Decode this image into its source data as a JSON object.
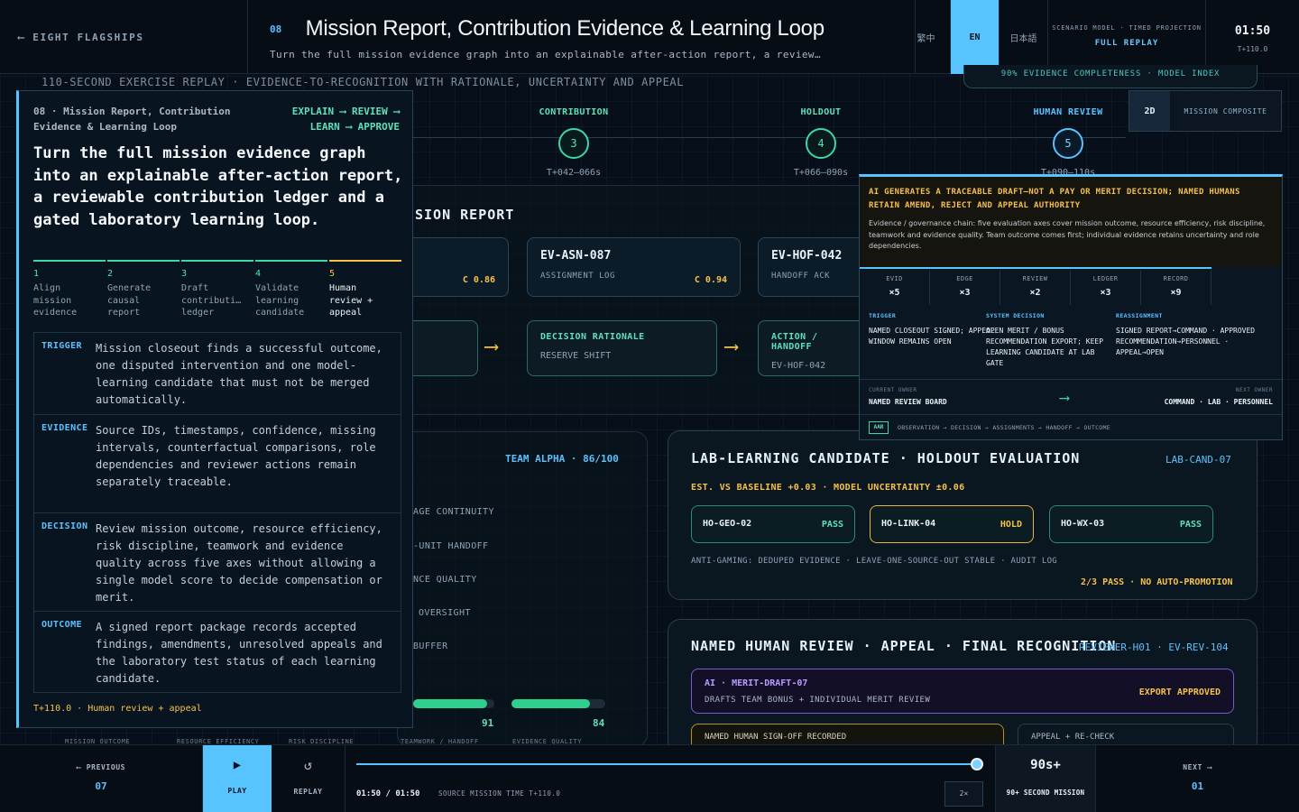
{
  "nav": {
    "back_label": "EIGHT FLAGSHIPS",
    "back_icon": "arrow-left-icon"
  },
  "header": {
    "number": "08",
    "title": "Mission Report, Contribution Evidence & Learning Loop",
    "subtitle": "Turn the full mission evidence graph into an explainable after-action report, a review…"
  },
  "languages": [
    "繁中",
    "EN",
    "日本語"
  ],
  "active_language": "EN",
  "mode": {
    "label": "SCENARIO MODEL · TIMED PROJECTION",
    "value": "FULL REPLAY"
  },
  "clock": {
    "time": "01:50",
    "offset": "T+110.0"
  },
  "subheader": "110-SECOND EXERCISE REPLAY · EVIDENCE-TO-RECOGNITION WITH RATIONALE, UNCERTAINTY AND APPEAL",
  "completeness_tab": "90% EVIDENCE COMPLETENESS · MODEL INDEX",
  "timeline": [
    {
      "label": "CONTRIBUTION",
      "number": "3",
      "time": "T+042–066s"
    },
    {
      "label": "HOLDOUT",
      "number": "4",
      "time": "T+066–090s"
    },
    {
      "label": "HUMAN REVIEW",
      "number": "5",
      "time": "T+090–110s"
    }
  ],
  "view_toggle": {
    "mode_2d": "2D",
    "composite": "MISSION COMPOSITE"
  },
  "mission_report": {
    "title": "SION REPORT",
    "evidence_cards": [
      {
        "id": "",
        "kind": "",
        "confidence": "C 0.86"
      },
      {
        "id": "EV-ASN-087",
        "kind": "ASSIGNMENT LOG",
        "confidence": "C 0.94"
      },
      {
        "id": "EV-HOF-042",
        "kind": "HANDOFF ACK",
        "confidence": ""
      }
    ],
    "flow_cards": [
      {
        "id": "DECISION RATIONALE",
        "kind": "RESERVE SHIFT"
      },
      {
        "id": "ACTION / HANDOFF",
        "kind": "EV-HOF-042"
      }
    ]
  },
  "team": {
    "score": "TEAM ALPHA · 86/100",
    "rows": [
      "AGE CONTINUITY",
      "-UNIT HANDOFF",
      "NCE QUALITY",
      "OVERSIGHT",
      "BUFFER"
    ],
    "bars": [
      {
        "value": 91,
        "fill": 0.91
      },
      {
        "value": 84,
        "fill": 0.84
      }
    ],
    "axis_labels": [
      "MISSION OUTCOME",
      "RESOURCE EFFICIENCY",
      "RISK DISCIPLINE",
      "TEAMWORK / HANDOFF",
      "EVIDENCE QUALITY"
    ]
  },
  "lab": {
    "title": "LAB-LEARNING CANDIDATE · HOLDOUT EVALUATION",
    "id": "LAB-CAND-07",
    "estimate": "EST. VS BASELINE +0.03 · MODEL UNCERTAINTY ±0.06",
    "holdouts": [
      {
        "id": "HO-GEO-02",
        "status": "PASS"
      },
      {
        "id": "HO-LINK-04",
        "status": "HOLD"
      },
      {
        "id": "HO-WX-03",
        "status": "PASS"
      }
    ],
    "anti_gaming": "ANTI-GAMING: DEDUPED EVIDENCE · LEAVE-ONE-SOURCE-OUT STABLE · AUDIT LOG",
    "summary": "2/3 PASS · NO AUTO-PROMOTION"
  },
  "human_review": {
    "title": "NAMED HUMAN REVIEW · APPEAL · FINAL RECOGNITION",
    "ids": "REVIEWER-H01 · EV-REV-104",
    "ai_card": {
      "label": "AI · MERIT-DRAFT-07",
      "desc": "DRAFTS TEAM BONUS + INDIVIDUAL MERIT REVIEW",
      "status": "EXPORT APPROVED"
    },
    "signoff": "NAMED HUMAN SIGN-OFF RECORDED",
    "appeal": "APPEAL + RE-CHECK"
  },
  "left_panel": {
    "header": "08 · Mission Report, Contribution Evidence & Learning Loop",
    "pipeline": "EXPLAIN ⟶ REVIEW ⟶\nLEARN ⟶ APPROVE",
    "headline": "Turn the full mission evidence graph into an explainable after-action report, a reviewable contribution ledger and a gated laboratory learning loop.",
    "steps": [
      {
        "n": "1",
        "text": "Align\nmission\nevidence"
      },
      {
        "n": "2",
        "text": "Generate\ncausal\nreport"
      },
      {
        "n": "3",
        "text": "Draft\ncontributi…\nledger"
      },
      {
        "n": "4",
        "text": "Validate\nlearning\ncandidate"
      },
      {
        "n": "5",
        "text": "Human\nreview +\nappeal"
      }
    ],
    "sections": [
      {
        "key": "TRIGGER",
        "value": "Mission closeout finds a successful outcome, one disputed intervention and one model-learning candidate that must not be merged automatically."
      },
      {
        "key": "EVIDENCE",
        "value": "Source IDs, timestamps, confidence, missing intervals, counterfactual comparisons, role dependencies and reviewer actions remain separately traceable."
      },
      {
        "key": "DECISION",
        "value": "Review mission outcome, resource efficiency, risk discipline, teamwork and evidence quality across five axes without allowing a single model score to decide compensation or merit."
      },
      {
        "key": "OUTCOME",
        "value": "A signed report package records accepted findings, amendments, unresolved appeals and the laboratory test status of each learning candidate."
      }
    ],
    "footer": "T+110.0 · Human review + appeal"
  },
  "right_panel": {
    "warning": "AI GENERATES A TRACEABLE DRAFT—NOT A PAY OR MERIT DECISION; NAMED HUMANS RETAIN AMEND, REJECT AND APPEAL AUTHORITY",
    "body": "Evidence / governance chain: five evaluation axes cover mission outcome, resource efficiency, risk discipline, teamwork and evidence quality. Team outcome comes first; individual evidence retains uncertainty and role dependencies.",
    "counts": [
      {
        "label": "EVID",
        "value": "×5"
      },
      {
        "label": "EDGE",
        "value": "×3"
      },
      {
        "label": "REVIEW",
        "value": "×2"
      },
      {
        "label": "LEDGER",
        "value": "×3"
      },
      {
        "label": "RECORD",
        "value": "×9"
      }
    ],
    "columns": [
      {
        "label": "TRIGGER",
        "value": "NAMED CLOSEOUT SIGNED; APPEAL WINDOW REMAINS OPEN"
      },
      {
        "label": "SYSTEM DECISION",
        "value": "OPEN MERIT / BONUS RECOMMENDATION EXPORT; KEEP LEARNING CANDIDATE AT LAB GATE"
      },
      {
        "label": "REASSIGNMENT",
        "value": "SIGNED REPORT→COMMAND · APPROVED RECOMMENDATION→PERSONNEL · APPEAL→OPEN"
      }
    ],
    "owner": {
      "current_label": "CURRENT OWNER",
      "current": "NAMED REVIEW BOARD",
      "next_label": "NEXT OWNER",
      "next": "COMMAND · LAB · PERSONNEL"
    },
    "aar": "AAR",
    "aar_flow": "OBSERVATION → DECISION → ASSIGNMENTS → HANDOFF → OUTCOME"
  },
  "player": {
    "prev_label": "PREVIOUS",
    "prev_num": "07",
    "play": "PLAY",
    "replay": "REPLAY",
    "times": "01:50 / 01:50",
    "source": "SOURCE MISSION TIME T+110.0",
    "progress": 1.0,
    "speed": "2×",
    "mission_len": "90s+",
    "mission_caption": "90+ SECOND MISSION",
    "next_label": "NEXT",
    "next_num": "01"
  }
}
